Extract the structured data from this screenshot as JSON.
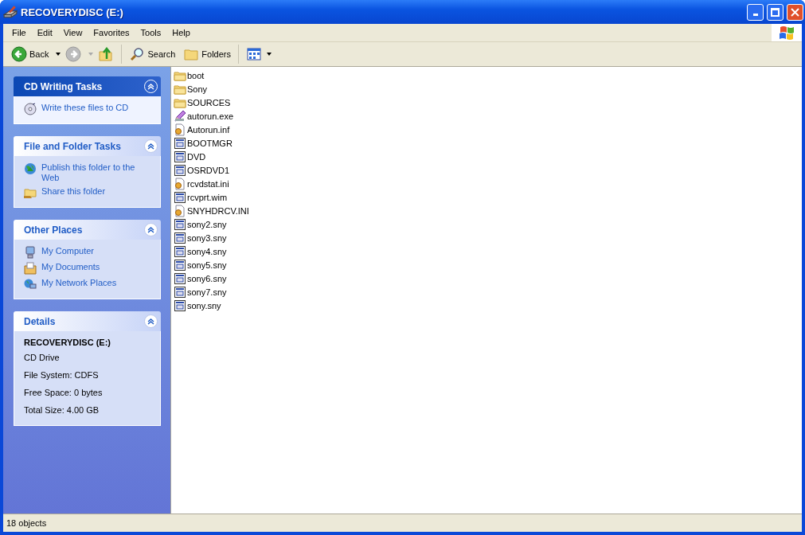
{
  "window": {
    "title": "RECOVERYDISC (E:)"
  },
  "menu": [
    "File",
    "Edit",
    "View",
    "Favorites",
    "Tools",
    "Help"
  ],
  "toolbar": [
    {
      "kind": "back",
      "label": "Back"
    },
    {
      "kind": "forward"
    },
    {
      "kind": "up"
    },
    {
      "kind": "search",
      "label": "Search"
    },
    {
      "kind": "folders",
      "label": "Folders"
    },
    {
      "kind": "views"
    }
  ],
  "panels": [
    {
      "title": "CD Writing Tasks",
      "kind": "special",
      "links": [
        {
          "label": "Write these files to CD",
          "kind": "cd"
        }
      ]
    },
    {
      "title": "File and Folder Tasks",
      "kind": "normal",
      "links": [
        {
          "label": "Publish this folder to the Web",
          "kind": "globe"
        },
        {
          "label": "Share this folder",
          "kind": "share"
        }
      ]
    },
    {
      "title": "Other Places",
      "kind": "normal",
      "links": [
        {
          "label": "My Computer",
          "kind": "computer"
        },
        {
          "label": "My Documents",
          "kind": "documents"
        },
        {
          "label": "My Network Places",
          "kind": "network"
        }
      ]
    },
    {
      "title": "Details",
      "kind": "details",
      "name": "RECOVERYDISC (E:)",
      "lines": [
        "CD Drive",
        "File System: CDFS",
        "Free Space: 0 bytes",
        "Total Size: 4.00 GB"
      ]
    }
  ],
  "files": [
    {
      "name": "boot",
      "kind": "folder"
    },
    {
      "name": "Sony",
      "kind": "folder"
    },
    {
      "name": "SOURCES",
      "kind": "folder"
    },
    {
      "name": "autorun.exe",
      "kind": "program"
    },
    {
      "name": "Autorun.inf",
      "kind": "settings"
    },
    {
      "name": "BOOTMGR",
      "kind": "system"
    },
    {
      "name": "DVD",
      "kind": "system"
    },
    {
      "name": "OSRDVD1",
      "kind": "system"
    },
    {
      "name": "rcvdstat.ini",
      "kind": "settings"
    },
    {
      "name": "rcvprt.wim",
      "kind": "system"
    },
    {
      "name": "SNYHDRCV.INI",
      "kind": "settings"
    },
    {
      "name": "sony2.sny",
      "kind": "system"
    },
    {
      "name": "sony3.sny",
      "kind": "system"
    },
    {
      "name": "sony4.sny",
      "kind": "system"
    },
    {
      "name": "sony5.sny",
      "kind": "system"
    },
    {
      "name": "sony6.sny",
      "kind": "system"
    },
    {
      "name": "sony7.sny",
      "kind": "system"
    },
    {
      "name": "sony.sny",
      "kind": "system"
    }
  ],
  "status_bar": {
    "text": "18 objects"
  }
}
